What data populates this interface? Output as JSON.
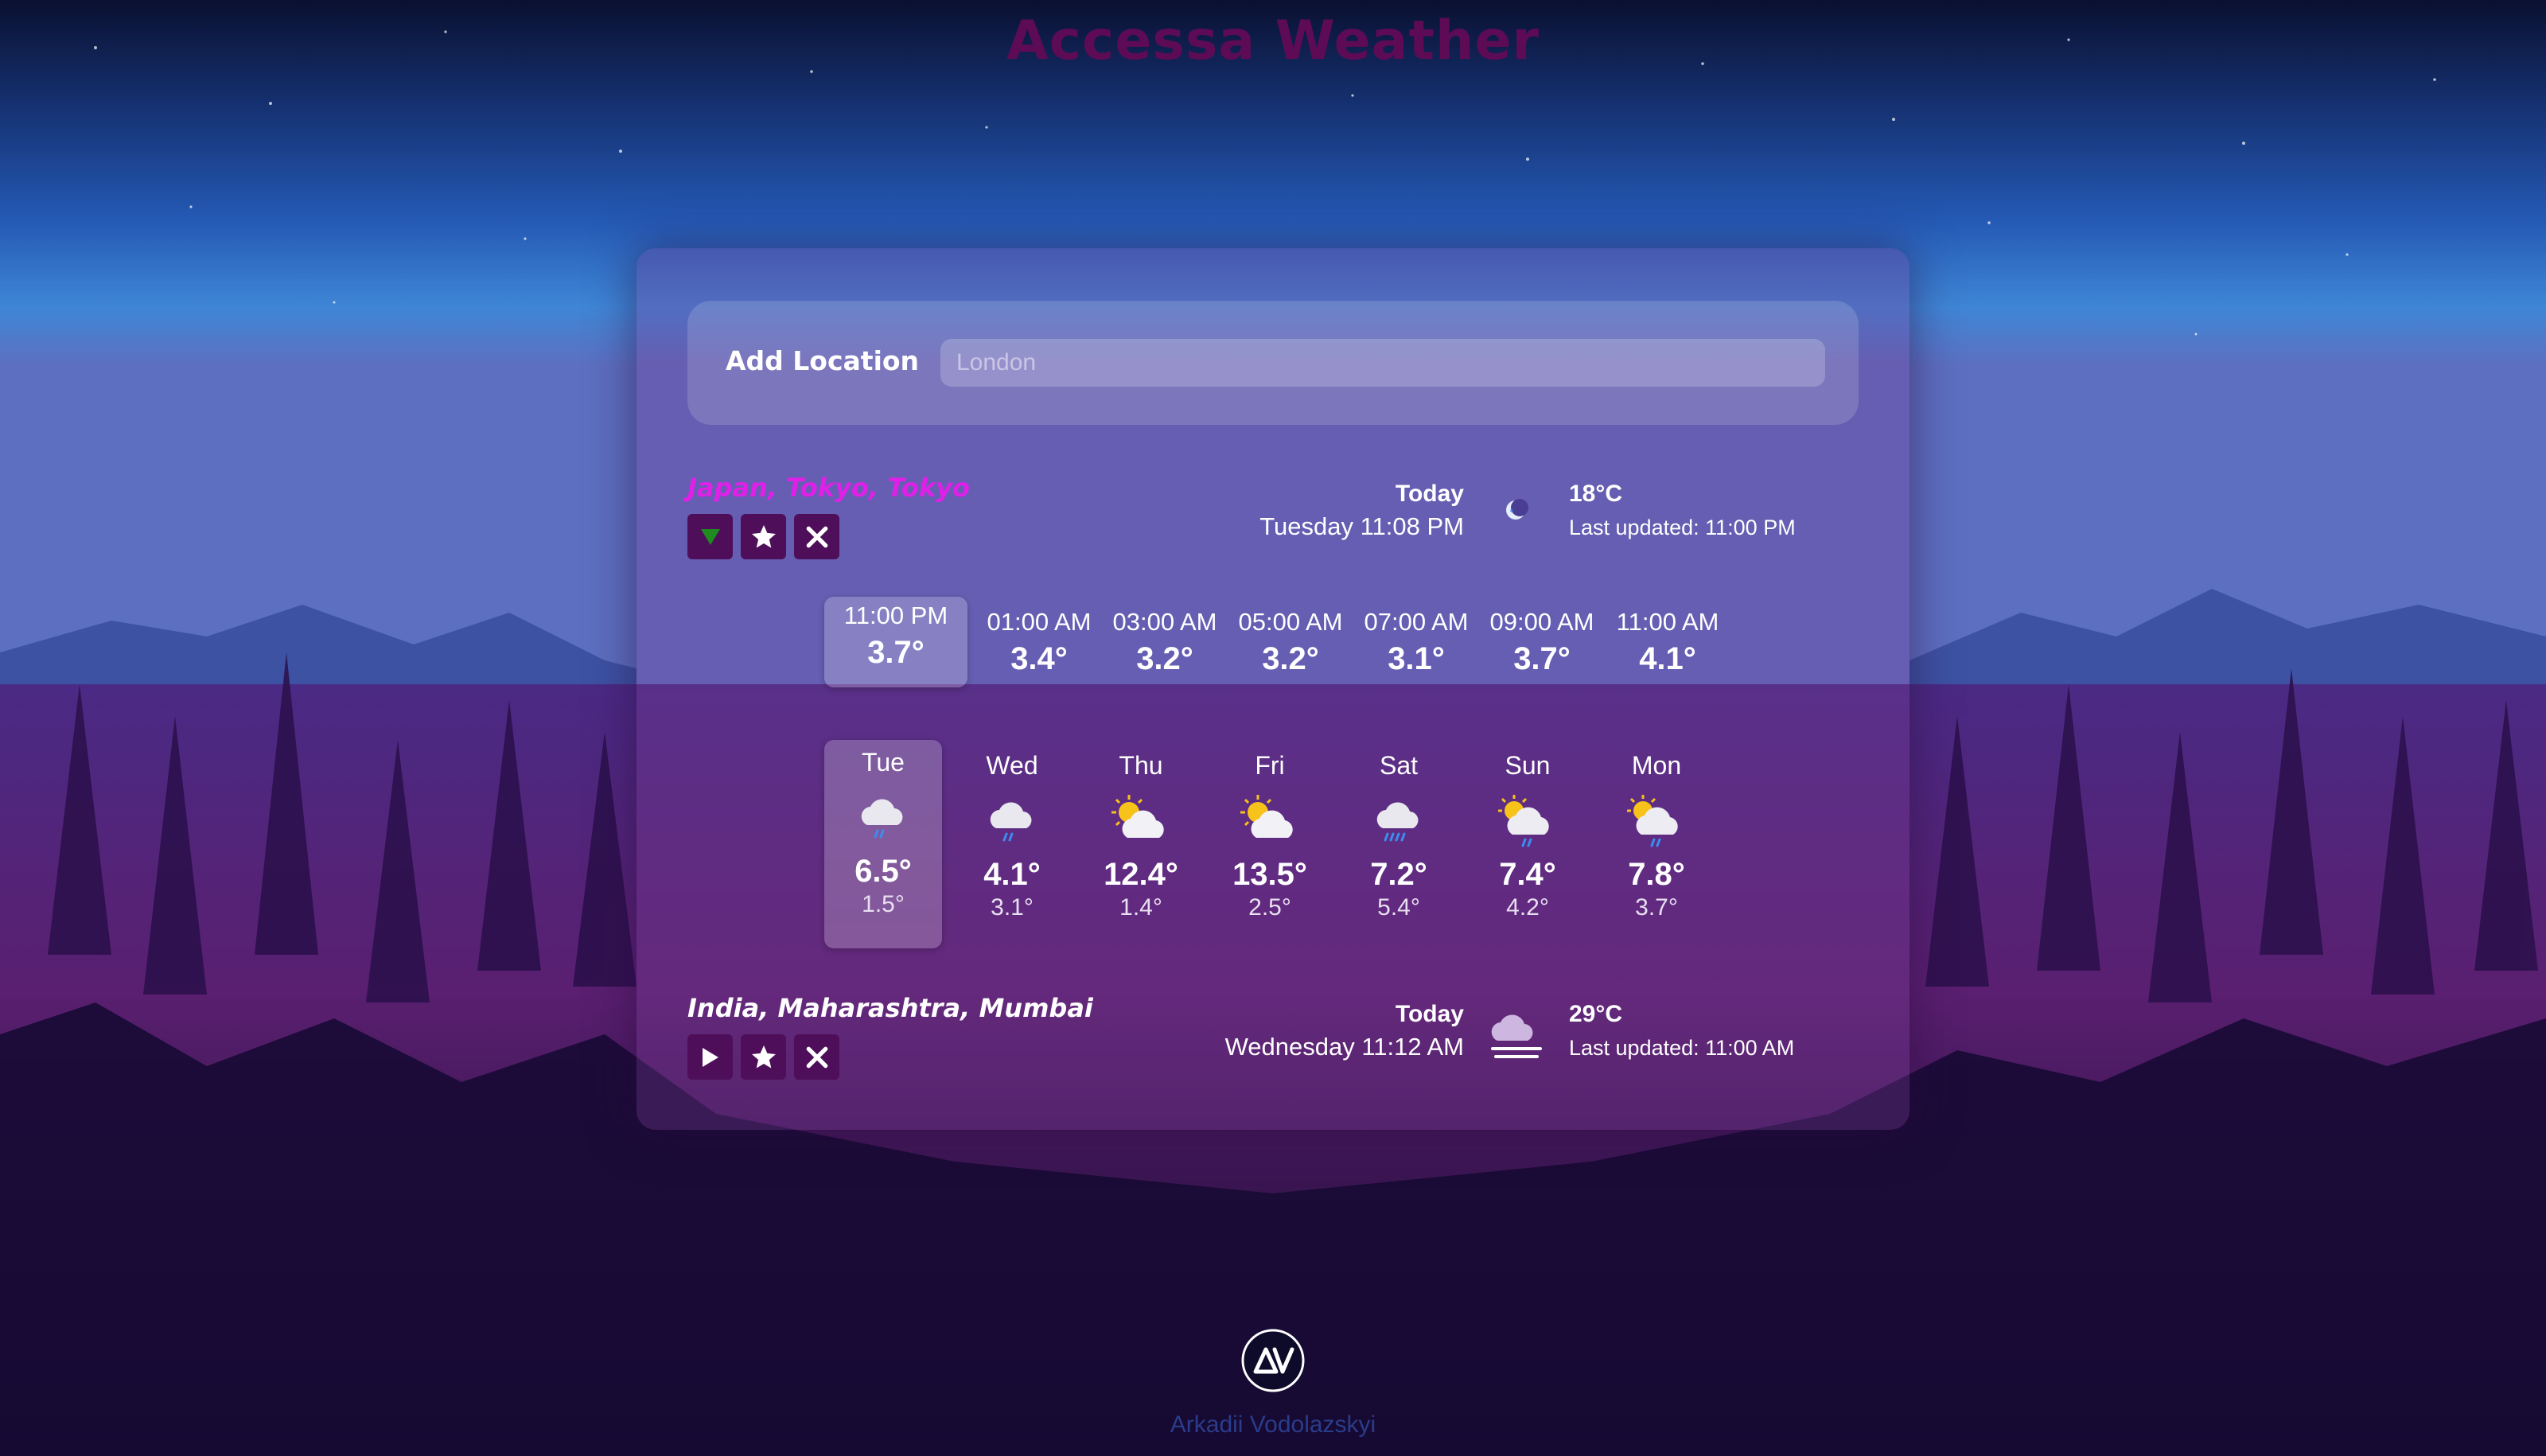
{
  "app": {
    "title": "Accessa Weather"
  },
  "add_location": {
    "label": "Add Location",
    "placeholder": "London",
    "value": ""
  },
  "locations": [
    {
      "name": "Japan, Tokyo, Tokyo",
      "name_color": "#e020e8",
      "expanded": true,
      "today_label": "Today",
      "datetime": "Tuesday 11:08 PM",
      "condition_icon": "crescent-moon-icon",
      "temperature": "18°C",
      "last_updated": "Last updated: 11:00 PM",
      "hourly": [
        {
          "time": "11:00 PM",
          "temp": "3.7°",
          "selected": true
        },
        {
          "time": "01:00 AM",
          "temp": "3.4°"
        },
        {
          "time": "03:00 AM",
          "temp": "3.2°"
        },
        {
          "time": "05:00 AM",
          "temp": "3.2°"
        },
        {
          "time": "07:00 AM",
          "temp": "3.1°"
        },
        {
          "time": "09:00 AM",
          "temp": "3.7°"
        },
        {
          "time": "11:00 AM",
          "temp": "4.1°"
        }
      ],
      "daily": [
        {
          "day": "Tue",
          "icon": "cloud-light-rain-icon",
          "high": "6.5°",
          "low": "1.5°",
          "selected": true
        },
        {
          "day": "Wed",
          "icon": "cloud-light-rain-icon",
          "high": "4.1°",
          "low": "3.1°"
        },
        {
          "day": "Thu",
          "icon": "sun-behind-cloud-icon",
          "high": "12.4°",
          "low": "1.4°"
        },
        {
          "day": "Fri",
          "icon": "sun-behind-cloud-icon",
          "high": "13.5°",
          "low": "2.5°"
        },
        {
          "day": "Sat",
          "icon": "cloud-heavy-rain-icon",
          "high": "7.2°",
          "low": "5.4°"
        },
        {
          "day": "Sun",
          "icon": "sun-cloud-rain-icon",
          "high": "7.4°",
          "low": "4.2°"
        },
        {
          "day": "Mon",
          "icon": "sun-cloud-rain-icon",
          "high": "7.8°",
          "low": "3.7°"
        }
      ]
    },
    {
      "name": "India, Maharashtra, Mumbai",
      "name_color": "#ffffff",
      "expanded": false,
      "today_label": "Today",
      "datetime": "Wednesday 11:12 AM",
      "condition_icon": "cloud-haze-icon",
      "temperature": "29°C",
      "last_updated": "Last updated: 11:00 AM"
    }
  ],
  "footer": {
    "logo_text": "AV",
    "author": "Arkadii Vodolazskyi"
  },
  "colors": {
    "button_bg": "#4e0e5a",
    "title": "#5e0b56",
    "expand_arrow": "#1f8a1f",
    "author": "#2a3c8a"
  }
}
